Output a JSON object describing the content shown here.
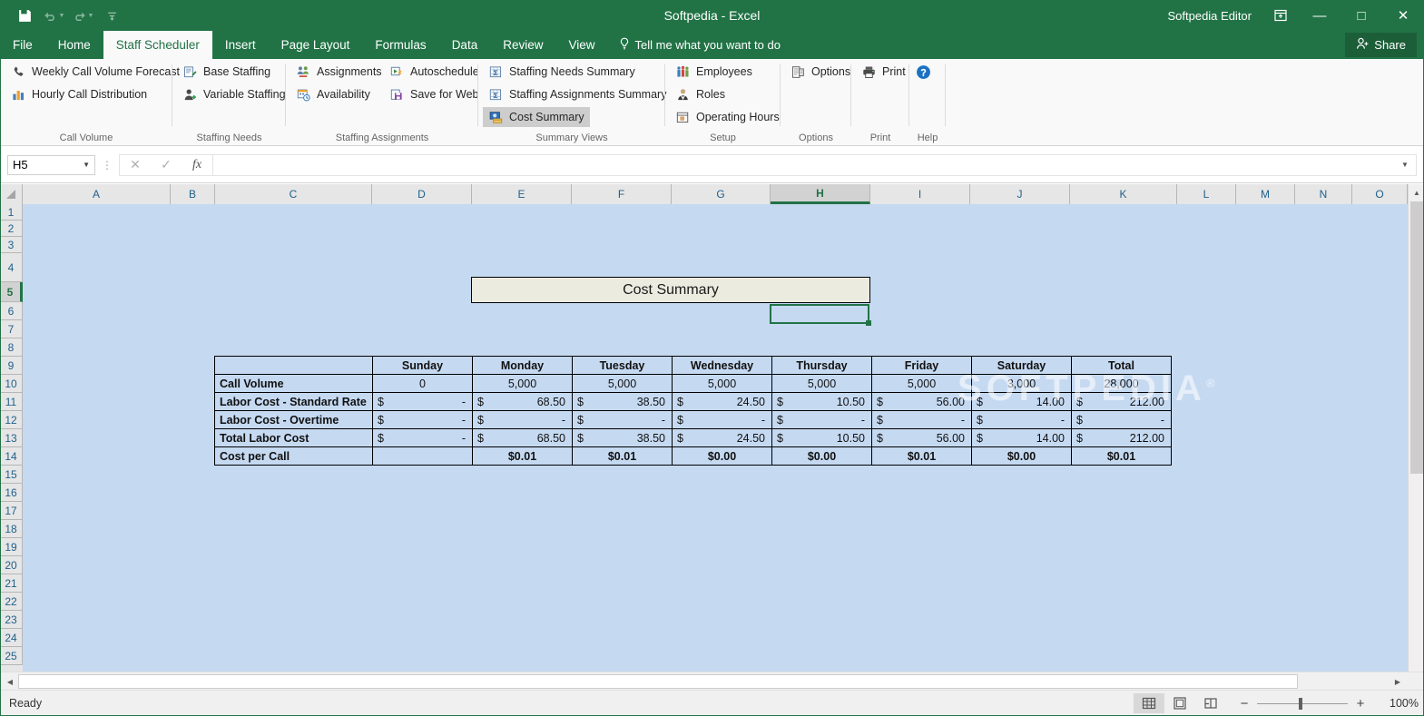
{
  "titlebar": {
    "document_title": "Softpedia - Excel",
    "account_name": "Softpedia Editor",
    "save_icon": "save-icon",
    "undo_icon": "undo-icon",
    "redo_icon": "redo-icon",
    "customize_qat_icon": "customize-quick-access-toolbar-icon",
    "ribbon_display_icon": "ribbon-display-options-icon",
    "minimize_label": "—",
    "maximize_label": "□",
    "close_label": "✕"
  },
  "tabs": [
    {
      "label": "File",
      "active": false
    },
    {
      "label": "Home",
      "active": false
    },
    {
      "label": "Staff Scheduler",
      "active": true
    },
    {
      "label": "Insert",
      "active": false
    },
    {
      "label": "Page Layout",
      "active": false
    },
    {
      "label": "Formulas",
      "active": false
    },
    {
      "label": "Data",
      "active": false
    },
    {
      "label": "Review",
      "active": false
    },
    {
      "label": "View",
      "active": false
    }
  ],
  "tellme": {
    "label": "Tell me what you want to do"
  },
  "share": {
    "label": "Share"
  },
  "ribbon": {
    "groups": [
      {
        "title": "Call Volume",
        "items": [
          {
            "label": "Weekly Call Volume Forecast",
            "icon": "phone-icon",
            "selected": false
          },
          {
            "label": "Hourly Call Distribution",
            "icon": "bar-chart-icon",
            "selected": false
          }
        ]
      },
      {
        "title": "Staffing Needs",
        "items": [
          {
            "label": "Base Staffing",
            "icon": "form-edit-icon",
            "selected": false
          },
          {
            "label": "Variable Staffing",
            "icon": "person-add-icon",
            "selected": false
          }
        ]
      },
      {
        "title": "Staffing Assignments",
        "items": [
          {
            "label": "Assignments",
            "icon": "people-group-icon",
            "selected": false
          },
          {
            "label": "Availability",
            "icon": "calendar-clock-icon",
            "selected": false
          }
        ]
      },
      {
        "title": "",
        "items": [
          {
            "label": "Autoschedule",
            "icon": "run-lightning-icon",
            "selected": false
          },
          {
            "label": "Save for Web",
            "icon": "save-web-icon",
            "selected": false
          }
        ]
      },
      {
        "title": "Summary Views",
        "items": [
          {
            "label": "Staffing Needs Summary",
            "icon": "sigma-table-icon",
            "selected": false
          },
          {
            "label": "Staffing Assignments Summary",
            "icon": "sigma-table-icon",
            "selected": false
          },
          {
            "label": "Cost Summary",
            "icon": "cost-summary-icon",
            "selected": true
          }
        ]
      },
      {
        "title": "Setup",
        "items": [
          {
            "label": "Employees",
            "icon": "employees-icon",
            "selected": false
          },
          {
            "label": "Roles",
            "icon": "role-person-icon",
            "selected": false
          },
          {
            "label": "Operating Hours",
            "icon": "operating-hours-icon",
            "selected": false
          }
        ]
      },
      {
        "title": "Options",
        "items": [
          {
            "label": "Options",
            "icon": "options-icon",
            "selected": false
          }
        ]
      },
      {
        "title": "Print",
        "items": [
          {
            "label": "Print",
            "icon": "printer-icon",
            "selected": false
          }
        ]
      },
      {
        "title": "Help",
        "items": [
          {
            "label": "",
            "icon": "help-question-icon",
            "selected": false
          }
        ]
      }
    ]
  },
  "formula_bar": {
    "name_box_value": "H5",
    "name_box_dropdown_icon": "chevron-down-icon",
    "cancel_icon": "cancel-icon",
    "enter_icon": "confirm-check-icon",
    "function_icon": "insert-function-fx-icon",
    "formula_value": "",
    "expand_icon": "expand-formula-bar-icon"
  },
  "grid": {
    "columns": [
      "A",
      "B",
      "C",
      "D",
      "E",
      "F",
      "G",
      "H",
      "I",
      "J",
      "K",
      "L",
      "M",
      "N",
      "O"
    ],
    "selected_column": "H",
    "rows": [
      "1",
      "2",
      "3",
      "4",
      "5",
      "6",
      "7",
      "8",
      "9",
      "10",
      "11",
      "12",
      "13",
      "14",
      "15",
      "16",
      "17",
      "18",
      "19",
      "20",
      "21",
      "22",
      "23",
      "24",
      "25"
    ],
    "selected_row": "5",
    "selected_cell": "H5",
    "sheet_title_cell": "Cost Summary",
    "watermark": "SOFTPEDIA"
  },
  "chart_data": {
    "type": "table",
    "title": "Cost Summary",
    "categories": [
      "Sunday",
      "Monday",
      "Tuesday",
      "Wednesday",
      "Thursday",
      "Friday",
      "Saturday",
      "Total"
    ],
    "headers": [
      "",
      "Sunday",
      "Monday",
      "Tuesday",
      "Wednesday",
      "Thursday",
      "Friday",
      "Saturday",
      "Total"
    ],
    "rows": [
      {
        "label": "Call Volume",
        "format": "number",
        "display": [
          "0",
          "5,000",
          "5,000",
          "5,000",
          "5,000",
          "5,000",
          "3,000",
          "28,000"
        ],
        "values": [
          0,
          5000,
          5000,
          5000,
          5000,
          5000,
          3000,
          28000
        ]
      },
      {
        "label": "Labor Cost - Standard Rate",
        "format": "currency",
        "display": [
          "-",
          "68.50",
          "38.50",
          "24.50",
          "10.50",
          "56.00",
          "14.00",
          "212.00"
        ],
        "values": [
          0,
          68.5,
          38.5,
          24.5,
          10.5,
          56.0,
          14.0,
          212.0
        ]
      },
      {
        "label": "Labor Cost - Overtime",
        "format": "currency",
        "display": [
          "-",
          "-",
          "-",
          "-",
          "-",
          "-",
          "-",
          "-"
        ],
        "values": [
          0,
          0,
          0,
          0,
          0,
          0,
          0,
          0
        ]
      },
      {
        "label": "Total Labor Cost",
        "format": "currency",
        "display": [
          "-",
          "68.50",
          "38.50",
          "24.50",
          "10.50",
          "56.00",
          "14.00",
          "212.00"
        ],
        "values": [
          0,
          68.5,
          38.5,
          24.5,
          10.5,
          56.0,
          14.0,
          212.0
        ]
      },
      {
        "label": "Cost per Call",
        "format": "currency-inline",
        "display": [
          "",
          "$0.01",
          "$0.01",
          "$0.00",
          "$0.00",
          "$0.01",
          "$0.00",
          "$0.01"
        ],
        "values": [
          null,
          0.01,
          0.01,
          0.0,
          0.0,
          0.01,
          0.0,
          0.01
        ]
      }
    ],
    "currency_symbol": "$"
  },
  "statusbar": {
    "status_text": "Ready",
    "view_normal_icon": "normal-view-icon",
    "view_pagelayout_icon": "page-layout-view-icon",
    "view_pagebreak_icon": "page-break-preview-icon",
    "zoom_out_label": "−",
    "zoom_in_label": "+",
    "zoom_level": "100%"
  }
}
